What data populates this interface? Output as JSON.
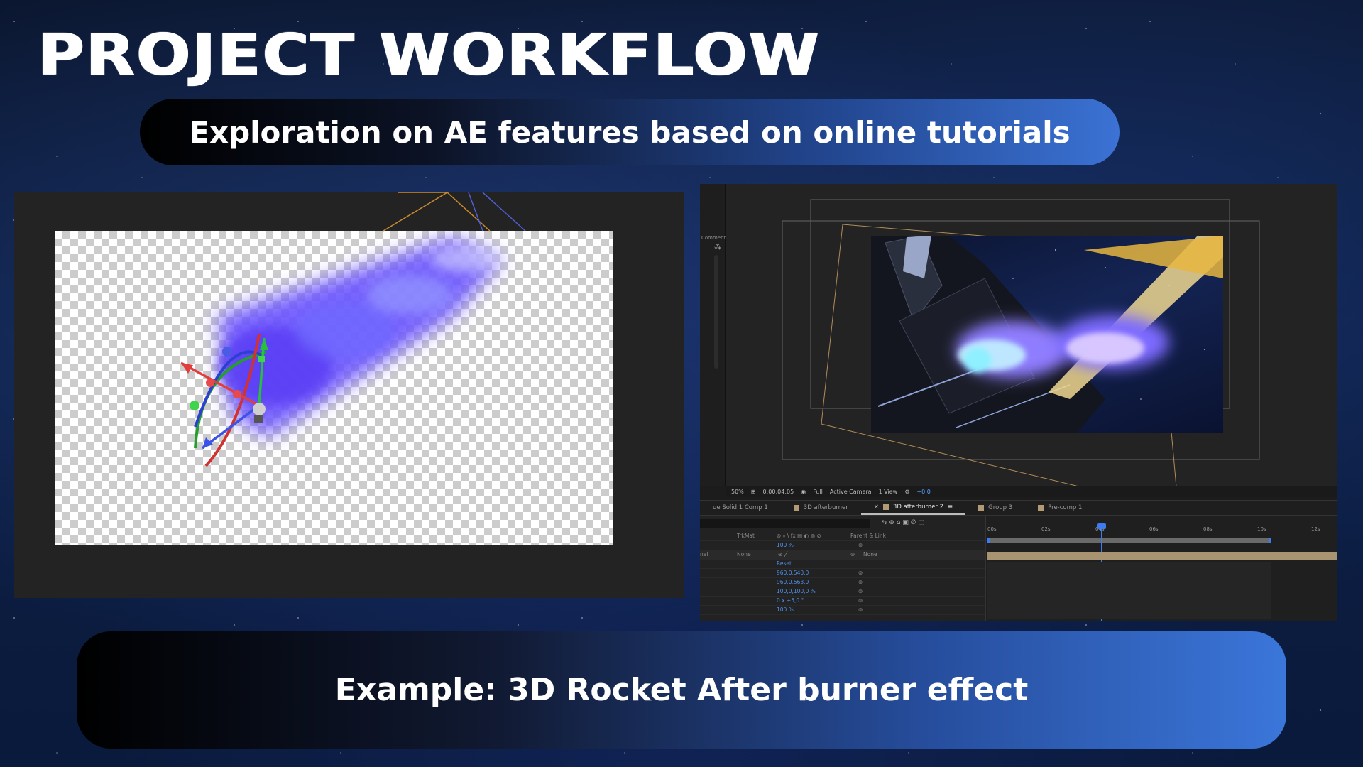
{
  "slide": {
    "title": "PROJECT WORKFLOW",
    "subtitle": "Exploration on AE features based on online tutorials",
    "caption": "Example: 3D Rocket After burner effect"
  },
  "colors": {
    "pill_start": "#000000",
    "pill_end": "#3b76da",
    "panel_bg": "#232323",
    "accent_blue": "#4f8fe8"
  },
  "ae": {
    "comment_label": "Comment",
    "toolbar": {
      "zoom": "50%",
      "timecode": "0;00;04;05",
      "resolution": "Full",
      "camera": "Active Camera",
      "views": "1 View",
      "exposure": "+0.0"
    },
    "tabs": [
      {
        "label": "ue Solid 1 Comp 1",
        "active": false
      },
      {
        "label": "3D afterburner",
        "active": false
      },
      {
        "label": "3D afterburner 2",
        "active": true
      },
      {
        "label": "Group 3",
        "active": false
      },
      {
        "label": "Pre-comp 1",
        "active": false
      }
    ],
    "columns": {
      "trkmat": "TrkMat",
      "parent": "Parent & Link"
    },
    "rows": {
      "opacity_top": "100 %",
      "mode": "nal",
      "trkmat_val": "None",
      "parent_val": "None",
      "reset": "Reset",
      "anchor": "960,0,540,0",
      "position": "960,0,563,0",
      "scale": "100,0,100,0 %",
      "rotation": "0 x +5,0 °",
      "opacity": "100 %"
    },
    "timeline_ticks": [
      "00s",
      "02s",
      "04s",
      "06s",
      "08s",
      "10s",
      "12s"
    ]
  }
}
